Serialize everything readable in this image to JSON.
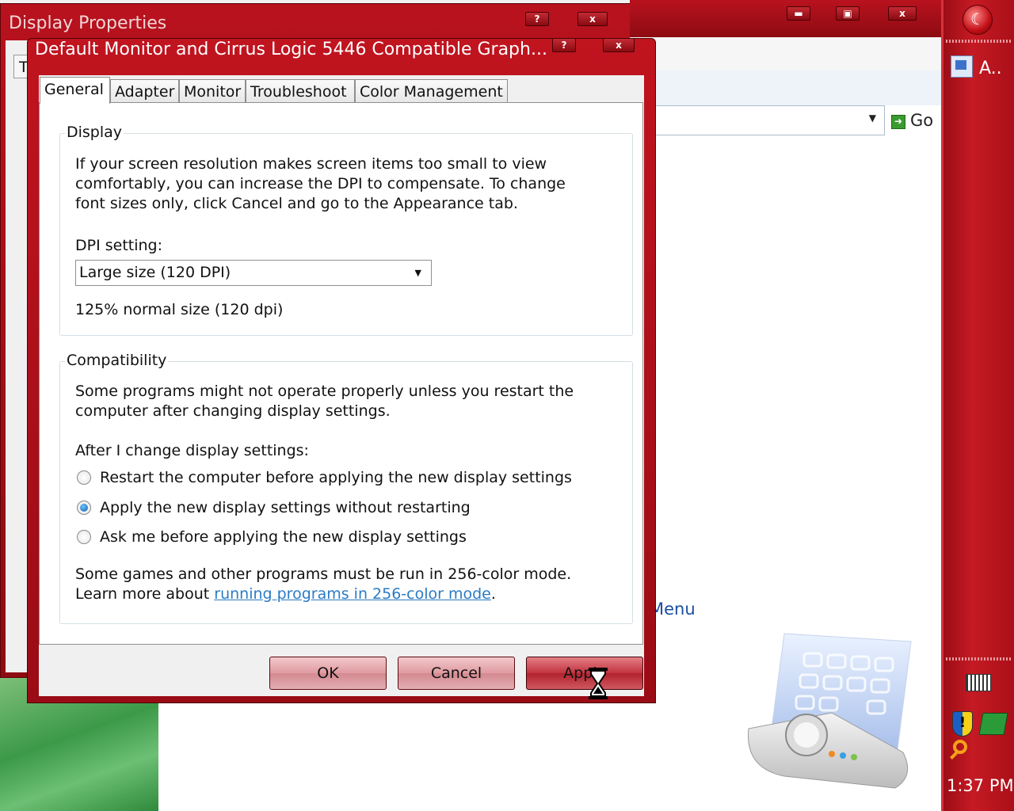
{
  "background_window": {
    "title": "Display Properties",
    "tab_fragment": "T",
    "help_label": "?",
    "close_label": "x"
  },
  "main_window": {
    "go_label": "Go",
    "menu_link_fragment": "Menu"
  },
  "dialog": {
    "title": "Default Monitor and Cirrus Logic 5446 Compatible Graph...",
    "help_label": "?",
    "close_label": "x",
    "tabs": [
      "General",
      "Adapter",
      "Monitor",
      "Troubleshoot",
      "Color Management"
    ],
    "active_tab": "General",
    "display_group": {
      "label": "Display",
      "description_lines": [
        "If your screen resolution makes screen items too small to view",
        "comfortably, you can increase the DPI to compensate.  To change",
        "font sizes only, click Cancel and go to the Appearance tab."
      ],
      "dpi_label": "DPI setting:",
      "dpi_value": "Large size (120 DPI)",
      "dpi_note": "125% normal size (120 dpi)"
    },
    "compat_group": {
      "label": "Compatibility",
      "description_lines": [
        "Some programs might not operate properly unless you restart the",
        "computer after changing display settings."
      ],
      "after_label": "After I change display settings:",
      "options": [
        {
          "label": "Restart the computer before applying the new display settings",
          "checked": false
        },
        {
          "label": "Apply the new display settings without restarting",
          "checked": true
        },
        {
          "label": "Ask me before applying the new display settings",
          "checked": false
        }
      ],
      "games_line": "Some games and other programs must be run in 256-color mode.",
      "learn_prefix": "Learn more about ",
      "learn_link": "running programs in 256-color mode",
      "learn_suffix": "."
    },
    "buttons": {
      "ok": "OK",
      "cancel": "Cancel",
      "apply": "Apply"
    }
  },
  "sidebar": {
    "app_label": "A..",
    "clock": "1:37 PM"
  },
  "colors": {
    "titlebar": "#b8121e",
    "link": "#2a7bc4",
    "button_face": "#df9aa0"
  }
}
